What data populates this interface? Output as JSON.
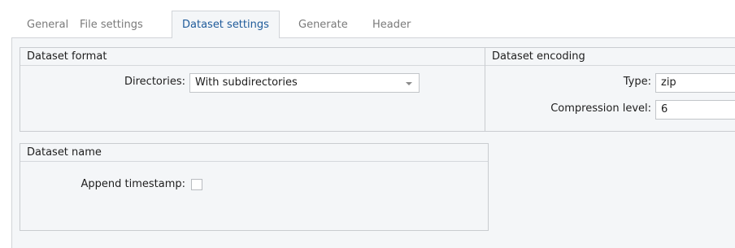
{
  "tabs": [
    {
      "label": "General"
    },
    {
      "label": "File settings"
    },
    {
      "label": "Dataset settings",
      "active": true
    },
    {
      "label": "Generate"
    },
    {
      "label": "Header"
    }
  ],
  "dataset_format": {
    "title": "Dataset format",
    "directories_label": "Directories:",
    "directories_value": "With subdirectories"
  },
  "dataset_encoding": {
    "title": "Dataset encoding",
    "type_label": "Type:",
    "type_value": "zip",
    "compression_label": "Compression level:",
    "compression_value": "6"
  },
  "dataset_name": {
    "title": "Dataset name",
    "timestamp_label": "Append timestamp:",
    "timestamp_checked": false
  },
  "colors": {
    "active_tab_text": "#1f5b9a",
    "panel_background": "#f4f6f8",
    "border": "#c9ccd0"
  }
}
